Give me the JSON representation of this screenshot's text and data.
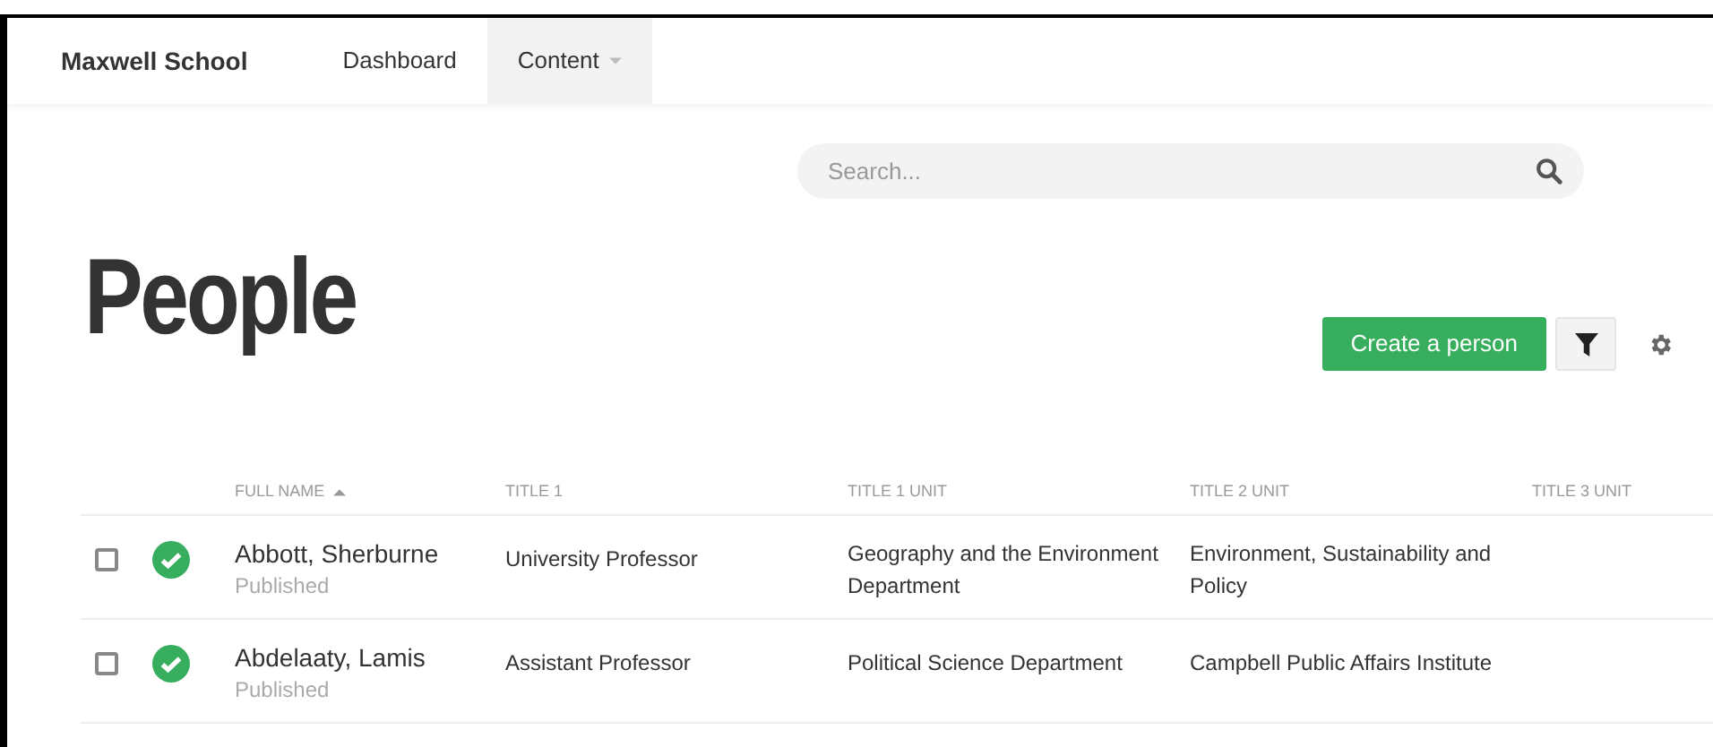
{
  "brand": "Maxwell School",
  "nav": [
    {
      "label": "Dashboard",
      "selected": false,
      "dropdown": false
    },
    {
      "label": "Content",
      "selected": true,
      "dropdown": true
    }
  ],
  "search": {
    "placeholder": "Search..."
  },
  "heading": "People",
  "actions": {
    "create_button": "Create a person"
  },
  "table": {
    "columns": [
      {
        "label": "FULL NAME",
        "sorted_ascending": true
      },
      {
        "label": "TITLE 1"
      },
      {
        "label": "TITLE 1 UNIT"
      },
      {
        "label": "TITLE 2 UNIT"
      },
      {
        "label": "TITLE 3 UNIT"
      }
    ],
    "rows": [
      {
        "checked": false,
        "published": true,
        "name": "Abbott, Sherburne",
        "status": "Published",
        "title_1": "University Professor",
        "title_1_unit": "Geography and the Environment Department",
        "title_2_unit": "Environment, Sustainability and Policy"
      },
      {
        "checked": false,
        "published": true,
        "name": "Abdelaaty, Lamis",
        "status": "Published",
        "title_1": "Assistant Professor",
        "title_1_unit": "Political Science Department",
        "title_2_unit": "Campbell Public Affairs Institute"
      }
    ]
  }
}
